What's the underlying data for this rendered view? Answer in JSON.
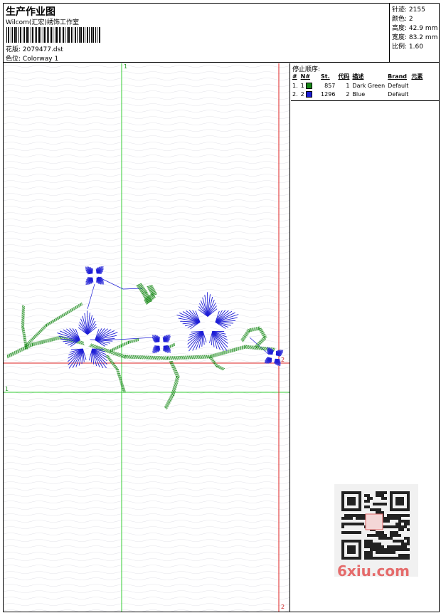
{
  "header": {
    "title": "生产作业图",
    "company": "Wilcom(汇宏)绣饰工作室",
    "pattern_label": "花版:",
    "pattern_value": "2079477.dst",
    "colorway_label": "色位:",
    "colorway_value": "Colorway 1"
  },
  "stats": [
    {
      "label": "针迹:",
      "value": "2155"
    },
    {
      "label": "颜色:",
      "value": "2"
    },
    {
      "label": "高度:",
      "value": "42.9 mm"
    },
    {
      "label": "宽度:",
      "value": "83.2 mm"
    },
    {
      "label": "比例:",
      "value": "1.60"
    }
  ],
  "stops": {
    "title": "停止顺序:",
    "columns": [
      "#",
      "N#",
      "St.",
      "代码",
      "描述",
      "Brand",
      "元素"
    ],
    "rows": [
      {
        "idx": "1.",
        "n": "1",
        "color": "#1a8a1a",
        "stitches": "857",
        "code": "1",
        "desc": "Dark Green",
        "brand": "Default"
      },
      {
        "idx": "2.",
        "n": "2",
        "color": "#1e1ed6",
        "stitches": "1296",
        "code": "2",
        "desc": "Blue",
        "brand": "Default"
      }
    ]
  },
  "guides": {
    "green_top": "1",
    "green_left": "1",
    "red_right": "2",
    "red_bottom": "2"
  },
  "colors": {
    "green_thread": "#1a8a1a",
    "blue_thread": "#1e1ed6",
    "guide_green": "#33cc33",
    "guide_red": "#dd2222"
  },
  "watermark": {
    "text": "6xiu.com"
  }
}
